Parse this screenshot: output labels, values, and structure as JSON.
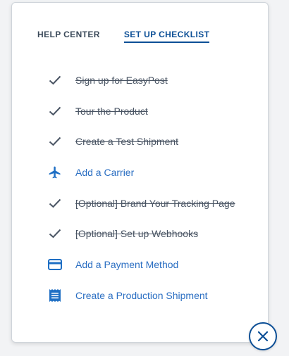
{
  "tabs": {
    "help_center": "HELP CENTER",
    "setup_checklist": "SET UP CHECKLIST"
  },
  "checklist": [
    {
      "label": "Sign up for EasyPost",
      "done": true,
      "icon": "check-icon"
    },
    {
      "label": "Tour the Product",
      "done": true,
      "icon": "check-icon"
    },
    {
      "label": "Create a Test Shipment",
      "done": true,
      "icon": "check-icon"
    },
    {
      "label": "Add a Carrier",
      "done": false,
      "icon": "airplane-icon"
    },
    {
      "label": "[Optional] Brand Your Tracking Page",
      "done": true,
      "icon": "check-icon"
    },
    {
      "label": "[Optional] Set up Webhooks",
      "done": true,
      "icon": "check-icon"
    },
    {
      "label": "Add a Payment Method",
      "done": false,
      "icon": "credit-card-icon"
    },
    {
      "label": "Create a Production Shipment",
      "done": false,
      "icon": "receipt-icon"
    }
  ],
  "colors": {
    "accent": "#0c4f96",
    "link": "#2a6ec2",
    "done_text": "#4a5564",
    "check": "#4a5564"
  }
}
